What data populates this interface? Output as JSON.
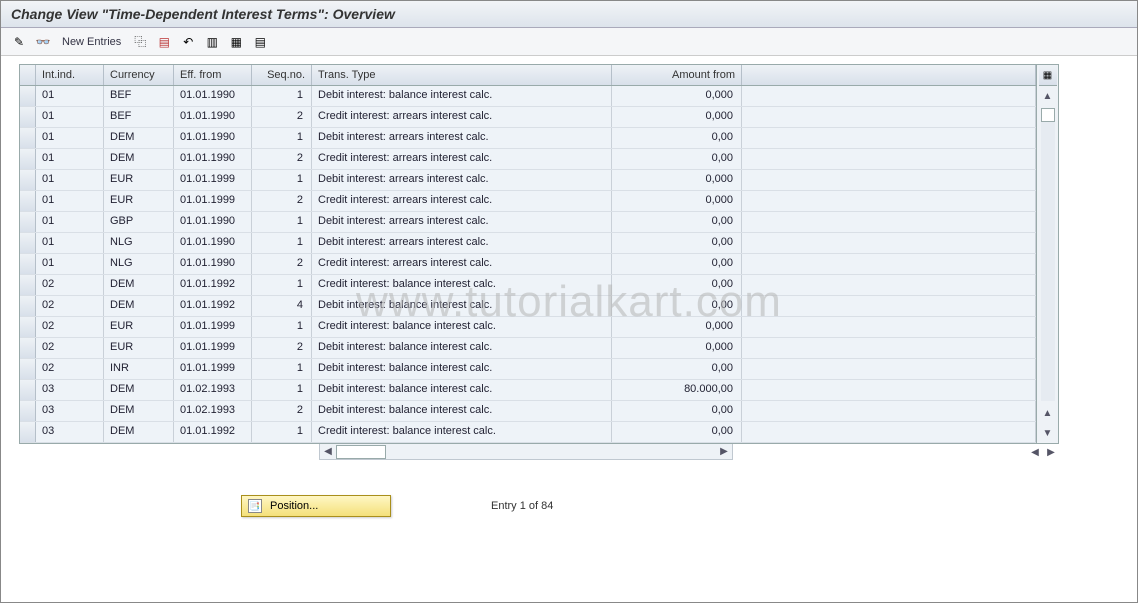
{
  "watermark": "www.tutorialkart.com",
  "title": "Change View \"Time-Dependent Interest Terms\": Overview",
  "toolbar": {
    "new_entries": "New Entries"
  },
  "columns": {
    "int_ind": "Int.ind.",
    "currency": "Currency",
    "eff_from": "Eff. from",
    "seq_no": "Seq.no.",
    "trans_type": "Trans. Type",
    "amount_from": "Amount from"
  },
  "rows": [
    {
      "ind": "01",
      "cur": "BEF",
      "eff": "01.01.1990",
      "seq": "1",
      "tt": "Debit interest: balance interest calc.",
      "amt": "0,000"
    },
    {
      "ind": "01",
      "cur": "BEF",
      "eff": "01.01.1990",
      "seq": "2",
      "tt": "Credit interest: arrears interest calc.",
      "amt": "0,000"
    },
    {
      "ind": "01",
      "cur": "DEM",
      "eff": "01.01.1990",
      "seq": "1",
      "tt": "Debit interest: arrears interest calc.",
      "amt": "0,00"
    },
    {
      "ind": "01",
      "cur": "DEM",
      "eff": "01.01.1990",
      "seq": "2",
      "tt": "Credit interest: arrears interest calc.",
      "amt": "0,00"
    },
    {
      "ind": "01",
      "cur": "EUR",
      "eff": "01.01.1999",
      "seq": "1",
      "tt": "Debit interest: arrears interest calc.",
      "amt": "0,000"
    },
    {
      "ind": "01",
      "cur": "EUR",
      "eff": "01.01.1999",
      "seq": "2",
      "tt": "Credit interest: arrears interest calc.",
      "amt": "0,000"
    },
    {
      "ind": "01",
      "cur": "GBP",
      "eff": "01.01.1990",
      "seq": "1",
      "tt": "Debit interest: arrears interest calc.",
      "amt": "0,00"
    },
    {
      "ind": "01",
      "cur": "NLG",
      "eff": "01.01.1990",
      "seq": "1",
      "tt": "Debit interest: arrears interest calc.",
      "amt": "0,00"
    },
    {
      "ind": "01",
      "cur": "NLG",
      "eff": "01.01.1990",
      "seq": "2",
      "tt": "Credit interest: arrears interest calc.",
      "amt": "0,00"
    },
    {
      "ind": "02",
      "cur": "DEM",
      "eff": "01.01.1992",
      "seq": "1",
      "tt": "Credit interest: balance interest calc.",
      "amt": "0,00"
    },
    {
      "ind": "02",
      "cur": "DEM",
      "eff": "01.01.1992",
      "seq": "4",
      "tt": "Debit interest: balance interest calc.",
      "amt": "0,00"
    },
    {
      "ind": "02",
      "cur": "EUR",
      "eff": "01.01.1999",
      "seq": "1",
      "tt": "Credit interest: balance interest calc.",
      "amt": "0,000"
    },
    {
      "ind": "02",
      "cur": "EUR",
      "eff": "01.01.1999",
      "seq": "2",
      "tt": "Debit interest: balance interest calc.",
      "amt": "0,000"
    },
    {
      "ind": "02",
      "cur": "INR",
      "eff": "01.01.1999",
      "seq": "1",
      "tt": "Debit interest: balance interest calc.",
      "amt": "0,00"
    },
    {
      "ind": "03",
      "cur": "DEM",
      "eff": "01.02.1993",
      "seq": "1",
      "tt": "Debit interest: balance interest calc.",
      "amt": "80.000,00"
    },
    {
      "ind": "03",
      "cur": "DEM",
      "eff": "01.02.1993",
      "seq": "2",
      "tt": "Debit interest: balance interest calc.",
      "amt": "0,00"
    },
    {
      "ind": "03",
      "cur": "DEM",
      "eff": "01.01.1992",
      "seq": "1",
      "tt": "Credit interest: balance interest calc.",
      "amt": "0,00"
    }
  ],
  "position_button": "Position...",
  "entry_status": "Entry 1 of 84"
}
